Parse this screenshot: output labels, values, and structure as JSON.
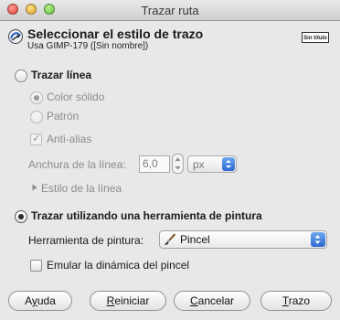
{
  "window": {
    "title": "Trazar ruta"
  },
  "header": {
    "title": "Seleccionar el estilo de trazo",
    "subtitle": "Usa GIMP-179 ([Sin nombre])",
    "thumb_text": "Sin título"
  },
  "stroke_line": {
    "label": "Trazar línea",
    "selected": false,
    "fill": {
      "solid_label": "Color sólido",
      "pattern_label": "Patrón",
      "selected": "solid"
    },
    "antialias": {
      "label": "Anti-alias",
      "checked": true
    },
    "width": {
      "label": "Anchura de la línea:",
      "value": "6,0",
      "unit": "px"
    },
    "line_style_label": "Estilo de la línea"
  },
  "paint_tool": {
    "label": "Trazar utilizando una herramienta de pintura",
    "selected": true,
    "tool_label": "Herramienta de pintura:",
    "tool_value": "Pincel",
    "emulate_label": "Emular la dinámica del pincel",
    "emulate_checked": false
  },
  "buttons": {
    "help": {
      "mnemonic": "y",
      "rest": "uda",
      "first": "A"
    },
    "reset": {
      "first": "R",
      "rest": "einiciar"
    },
    "cancel": {
      "first": "C",
      "rest": "ancelar"
    },
    "stroke": {
      "first": "T",
      "rest": "razo"
    }
  }
}
